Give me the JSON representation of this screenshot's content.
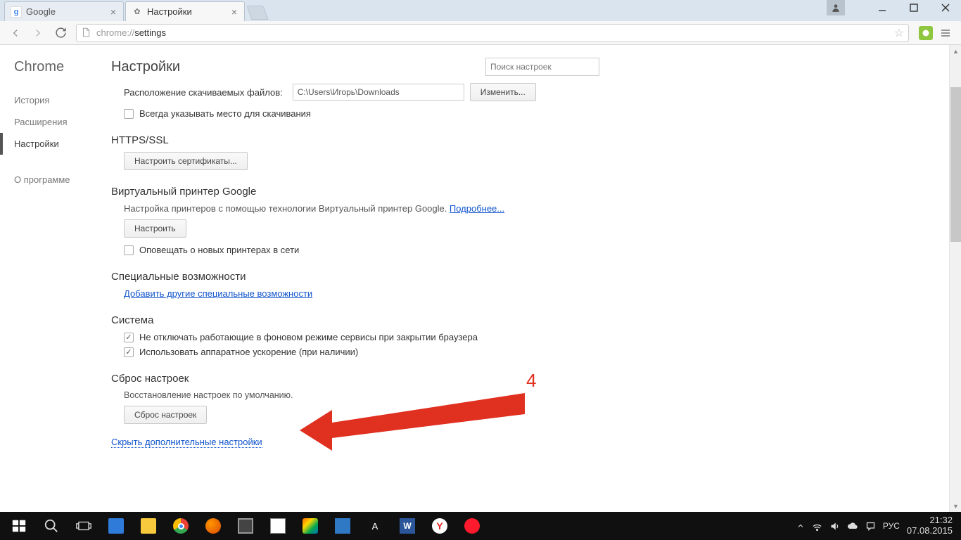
{
  "window": {
    "tabs": [
      {
        "title": "Google",
        "favicon": "g"
      },
      {
        "title": "Настройки",
        "favicon": "gear"
      }
    ]
  },
  "toolbar": {
    "url_prefix": "chrome://",
    "url_path": "settings"
  },
  "sidebar": {
    "brand": "Chrome",
    "items": [
      "История",
      "Расширения",
      "Настройки"
    ],
    "active_index": 2,
    "about": "О программе"
  },
  "settings": {
    "title": "Настройки",
    "search_placeholder": "Поиск настроек",
    "downloads": {
      "label": "Расположение скачиваемых файлов:",
      "path": "C:\\Users\\Игорь\\Downloads",
      "change_btn": "Изменить...",
      "ask_checkbox": "Всегда указывать место для скачивания",
      "ask_checked": false
    },
    "https": {
      "heading": "HTTPS/SSL",
      "manage_btn": "Настроить сертификаты..."
    },
    "cloudprint": {
      "heading": "Виртуальный принтер Google",
      "desc": "Настройка принтеров с помощью технологии Виртуальный принтер Google.",
      "more_link": "Подробнее...",
      "configure_btn": "Настроить",
      "notify_checkbox": "Оповещать о новых принтерах в сети",
      "notify_checked": false
    },
    "a11y": {
      "heading": "Специальные возможности",
      "add_link": "Добавить другие специальные возможности"
    },
    "system": {
      "heading": "Система",
      "bg_checkbox": "Не отключать работающие в фоновом режиме сервисы при закрытии браузера",
      "bg_checked": true,
      "hw_checkbox": "Использовать аппаратное ускорение (при наличии)",
      "hw_checked": true
    },
    "reset": {
      "heading": "Сброс настроек",
      "desc": "Восстановление настроек по умолчанию.",
      "btn": "Сброс настроек"
    },
    "hide_link": "Скрыть дополнительные настройки"
  },
  "annotation": {
    "number": "4"
  },
  "taskbar": {
    "lang": "РУС",
    "time": "21:32",
    "date": "07.08.2015"
  }
}
